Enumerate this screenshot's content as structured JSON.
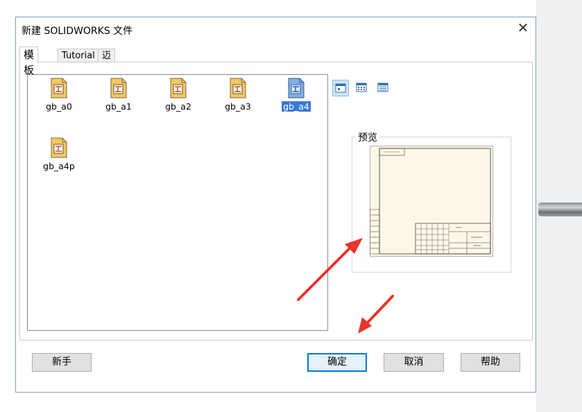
{
  "window": {
    "title": "新建 SOLIDWORKS 文件"
  },
  "tabs": [
    {
      "label": "模板"
    },
    {
      "label": "Tutorial"
    },
    {
      "label": "迈迪标准模版"
    }
  ],
  "templates": [
    {
      "label": "gb_a0",
      "selected": false
    },
    {
      "label": "gb_a1",
      "selected": false
    },
    {
      "label": "gb_a2",
      "selected": false
    },
    {
      "label": "gb_a3",
      "selected": false
    },
    {
      "label": "gb_a4",
      "selected": true
    },
    {
      "label": "gb_a4p",
      "selected": false
    }
  ],
  "view_buttons": [
    {
      "icon": "large-icons-view-icon",
      "active": true
    },
    {
      "icon": "list-view-icon",
      "active": false
    },
    {
      "icon": "details-view-icon",
      "active": false
    }
  ],
  "preview": {
    "label": "预览"
  },
  "buttons": {
    "novice": "新手",
    "ok": "确定",
    "cancel": "取消",
    "help": "帮助"
  },
  "colors": {
    "accent": "#0078d7",
    "selection": "#3b78d8",
    "arrow": "#e8352b",
    "icon_fill": "#f4c863"
  }
}
